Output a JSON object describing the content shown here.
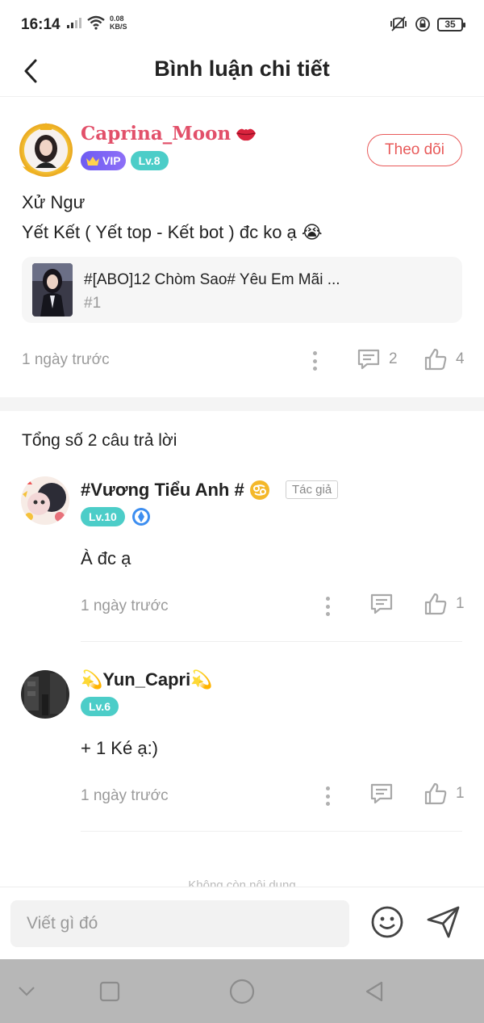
{
  "status_bar": {
    "time": "16:14",
    "net_speed_value": "0.08",
    "net_speed_unit": "KB/S",
    "battery": "35"
  },
  "header": {
    "title": "Bình luận chi tiết"
  },
  "post": {
    "username": "Caprina_Moon",
    "vip_label": "VIP",
    "level": "Lv.8",
    "follow_label": "Theo dõi",
    "body_line1": "Xử Ngư",
    "body_line2": "Yết Kết ( Yết top - Kết bot ) đc ko ạ 😭",
    "linked_story": {
      "title": "#[ABO]12 Chòm Sao# Yêu Em Mãi ...",
      "chapter": "#1"
    },
    "time": "1 ngày trước",
    "comment_count": "2",
    "like_count": "4"
  },
  "replies_title": "Tổng số 2 câu trả lời",
  "replies": [
    {
      "name": "#Vương Tiểu Anh #",
      "author_tag": "Tác giả",
      "level": "Lv.10",
      "text": "À đc ạ",
      "time": "1 ngày trước",
      "like_count": "1"
    },
    {
      "name": "💫Yun_Capri💫",
      "level": "Lv.6",
      "text": "+ 1 Ké ạ:)",
      "time": "1 ngày trước",
      "like_count": "1"
    }
  ],
  "end_text": "Không còn nội dung",
  "composer": {
    "placeholder": "Viết gì đó"
  },
  "colors": {
    "username_red": "#e2506a",
    "follow_red": "#e85a5a",
    "level_teal": "#4ccdc8",
    "vip_purple": "#7a62f4",
    "muted_gray": "#9a9a9a"
  },
  "icons": {
    "back": "chevron-left-icon",
    "more": "more-vertical-icon",
    "comment": "comment-icon",
    "like": "thumbs-up-icon",
    "emoji": "smiley-icon",
    "send": "send-icon"
  }
}
